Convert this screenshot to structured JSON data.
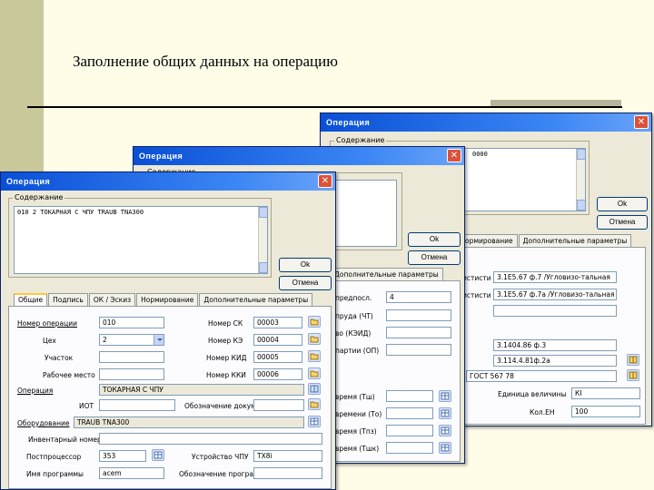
{
  "slide": {
    "title": "Заполнение общих данных на операцию"
  },
  "windows": {
    "back": {
      "title": "Операция",
      "group_label": "Содержание",
      "memo_text": "0000",
      "ok": "Ok",
      "cancel": "Отмена",
      "tabs": [
        "ормирование",
        "Дополнительные параметры"
      ],
      "rows": [
        {
          "label": "истисти",
          "value": "3.1Е5.67 ф.7 /Угловизо-тальная"
        },
        {
          "label": "истисти",
          "value": "3.1Е5.67 ф.7а /Угловизо-тальная"
        },
        {
          "label": "",
          "value": ""
        },
        {
          "label": "",
          "value": "3.1404.86 ф.3"
        },
        {
          "label": "",
          "value": "3.114.4.81ф.2а"
        },
        {
          "label": "",
          "value": "ГОСТ 567 78"
        }
      ],
      "unit_label": "Единица величины",
      "unit_value": "КI",
      "qty_label": "Кол.ЕН",
      "qty_value": "100"
    },
    "middle": {
      "title": "Операция",
      "group_label": "Содержание",
      "ok": "Ok",
      "cancel": "Отмена",
      "tabs": [
        "Дополнительные параметры"
      ],
      "rows_top": [
        {
          "label": "предпосл.",
          "value": "4"
        },
        {
          "label": "пруда (ЧТ)",
          "value": ""
        },
        {
          "label": "во (КЭИД)",
          "value": ""
        },
        {
          "label": "партии (ОП)",
          "value": ""
        }
      ],
      "rows_bottom": [
        {
          "label": "время (Тш)",
          "value": ""
        },
        {
          "label": "времени (То)",
          "value": ""
        },
        {
          "label": "время (Тпз)",
          "value": ""
        },
        {
          "label": "время (Тшк)",
          "value": ""
        }
      ]
    },
    "front": {
      "title": "Операция",
      "group_label": "Содержание",
      "memo_text": "010 2 ТОКАРНАЯ С ЧПУ TRAUB TNA300",
      "ok": "Ok",
      "cancel": "Отмена",
      "tabs": [
        "Общие",
        "Подпись",
        "ОК / Эскиз",
        "Нормирование",
        "Дополнительные параметры"
      ],
      "active_tab": 0,
      "fields": {
        "op_number": {
          "label": "Номер операции",
          "value": "010"
        },
        "workshop": {
          "label": "Цех",
          "value": "2"
        },
        "section": {
          "label": "Участок",
          "value": ""
        },
        "workplace": {
          "label": "Рабочее место",
          "value": ""
        },
        "sk_number": {
          "label": "Номер СК",
          "value": "00003"
        },
        "ke_number": {
          "label": "Номер КЭ",
          "value": "00004"
        },
        "kid_number": {
          "label": "Номер КИД",
          "value": "00005"
        },
        "kki_number": {
          "label": "Номер ККИ",
          "value": "00006"
        },
        "operation": {
          "label": "Операция",
          "value": "ТОКАРНАЯ С ЧПУ"
        },
        "iot": {
          "label": "ИОТ",
          "value": ""
        },
        "docs": {
          "label": "Обозначение документов",
          "value": ""
        },
        "equipment": {
          "label": "Оборудование",
          "value": "TRAUB TNA300"
        },
        "inventory": {
          "label": "Инвентарный номер",
          "value": ""
        },
        "postprocessor": {
          "label": "Постпроцессор",
          "value": "353"
        },
        "cnc_device": {
          "label": "Устройство ЧПУ",
          "value": "TX8i"
        },
        "program_name": {
          "label": "Имя программы",
          "value": "acem"
        },
        "program_id": {
          "label": "Обозначение программы",
          "value": ""
        }
      }
    }
  },
  "colors": {
    "title_bar": "#0a4fd6",
    "window_bg": "#ece9d8",
    "slide_bg": "#fffde8",
    "stripe": "#c9c89a"
  },
  "icons": [
    "close-icon",
    "folder-open-icon",
    "book-icon",
    "grid-icon"
  ]
}
